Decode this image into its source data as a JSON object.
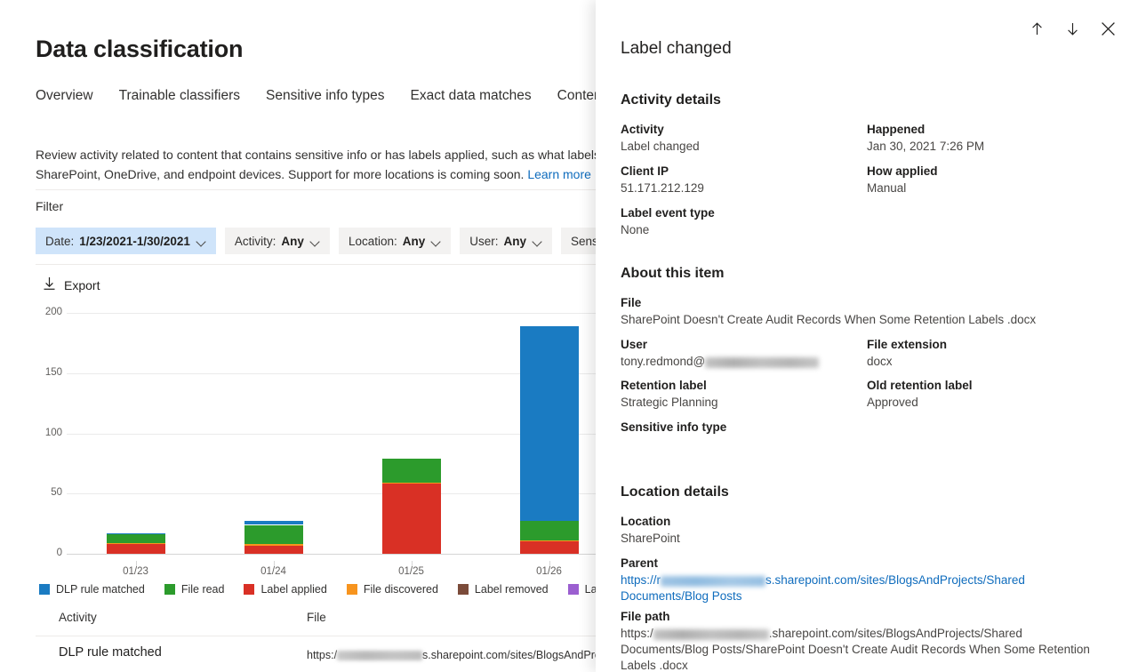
{
  "page": {
    "title": "Data classification",
    "tabs": [
      {
        "label": "Overview"
      },
      {
        "label": "Trainable classifiers"
      },
      {
        "label": "Sensitive info types"
      },
      {
        "label": "Exact data matches"
      },
      {
        "label": "Content exp"
      }
    ],
    "intro_line1": "Review activity related to content that contains sensitive info or has labels applied, such as what labels wer",
    "intro_line2": "SharePoint, OneDrive, and endpoint devices. Support for more locations is coming soon.",
    "intro_link": "Learn more"
  },
  "filter": {
    "label": "Filter",
    "pills": [
      {
        "key": "Date:",
        "value": "1/23/2021-1/30/2021",
        "selected": true
      },
      {
        "key": "Activity:",
        "value": "Any",
        "selected": false
      },
      {
        "key": "Location:",
        "value": "Any",
        "selected": false
      },
      {
        "key": "User:",
        "value": "Any",
        "selected": false
      },
      {
        "key": "Sensi",
        "value": "",
        "selected": false
      }
    ]
  },
  "toolbar": {
    "export_label": "Export",
    "export_icon": "download-icon"
  },
  "chart_data": {
    "type": "bar",
    "stacked": true,
    "title": "",
    "xlabel": "",
    "ylabel": "",
    "ylim": [
      0,
      200
    ],
    "yticks": [
      0,
      50,
      100,
      150,
      200
    ],
    "grid": true,
    "legend_position": "bottom",
    "categories": [
      "01/23",
      "01/24",
      "01/25",
      "01/26"
    ],
    "series": [
      {
        "name": "Label applied",
        "color": "#d93025",
        "values": [
          8,
          7,
          58,
          10
        ]
      },
      {
        "name": "File discovered",
        "color": "#f7941e",
        "values": [
          1,
          1,
          1,
          1
        ]
      },
      {
        "name": "File read",
        "color": "#2c9b2c",
        "values": [
          7,
          16,
          20,
          16
        ]
      },
      {
        "name": "DLP rule matched",
        "color": "#1a7bc2",
        "values": [
          1,
          3,
          0,
          162
        ]
      },
      {
        "name": "Label removed",
        "color": "#7b4b3a",
        "values": [
          0,
          0,
          0,
          0
        ]
      },
      {
        "name": "Label changed",
        "color": "#9b5fd0",
        "values": [
          0,
          0,
          0,
          0
        ]
      }
    ],
    "legend": [
      {
        "label": "DLP rule matched",
        "color": "#1a7bc2"
      },
      {
        "label": "File read",
        "color": "#2c9b2c"
      },
      {
        "label": "Label applied",
        "color": "#d93025"
      },
      {
        "label": "File discovered",
        "color": "#f7941e"
      },
      {
        "label": "Label removed",
        "color": "#7b4b3a"
      },
      {
        "label": "Label ch",
        "color": "#9b5fd0"
      }
    ]
  },
  "table": {
    "columns": [
      {
        "label": "Activity"
      },
      {
        "label": "File"
      }
    ],
    "rows": [
      {
        "activity": "DLP rule matched",
        "file_prefix": "https:/",
        "file_suffix": "s.sharepoint.com/sites/BlogsAndProje"
      }
    ]
  },
  "panel": {
    "title": "Label changed",
    "actions": [
      {
        "name": "previous-item",
        "icon": "arrow-up-icon"
      },
      {
        "name": "next-item",
        "icon": "arrow-down-icon"
      },
      {
        "name": "close-panel",
        "icon": "close-icon"
      }
    ],
    "activity_details": {
      "heading": "Activity details",
      "activity_label": "Activity",
      "activity_value": "Label changed",
      "happened_label": "Happened",
      "happened_value": "Jan 30, 2021 7:26 PM",
      "client_ip_label": "Client IP",
      "client_ip_value": "51.171.212.129",
      "how_applied_label": "How applied",
      "how_applied_value": "Manual",
      "label_event_type_label": "Label event type",
      "label_event_type_value": "None"
    },
    "about_item": {
      "heading": "About this item",
      "file_label": "File",
      "file_value": "SharePoint Doesn't Create Audit Records When Some Retention Labels .docx",
      "user_label": "User",
      "user_value_prefix": "tony.redmond@",
      "file_extension_label": "File extension",
      "file_extension_value": "docx",
      "retention_label_label": "Retention label",
      "retention_label_value": "Strategic Planning",
      "old_retention_label_label": "Old retention label",
      "old_retention_label_value": "Approved",
      "sensitive_info_type_label": "Sensitive info type",
      "sensitive_info_type_value": ""
    },
    "location_details": {
      "heading": "Location details",
      "location_label": "Location",
      "location_value": "SharePoint",
      "parent_label": "Parent",
      "parent_prefix": "https://r",
      "parent_suffix": "s.sharepoint.com/sites/BlogsAndProjects/Shared Documents/Blog Posts",
      "file_path_label": "File path",
      "file_path_prefix": "https:/",
      "file_path_suffix": ".sharepoint.com/sites/BlogsAndProjects/Shared Documents/Blog Posts/SharePoint Doesn't Create Audit Records When Some Retention Labels .docx"
    }
  }
}
